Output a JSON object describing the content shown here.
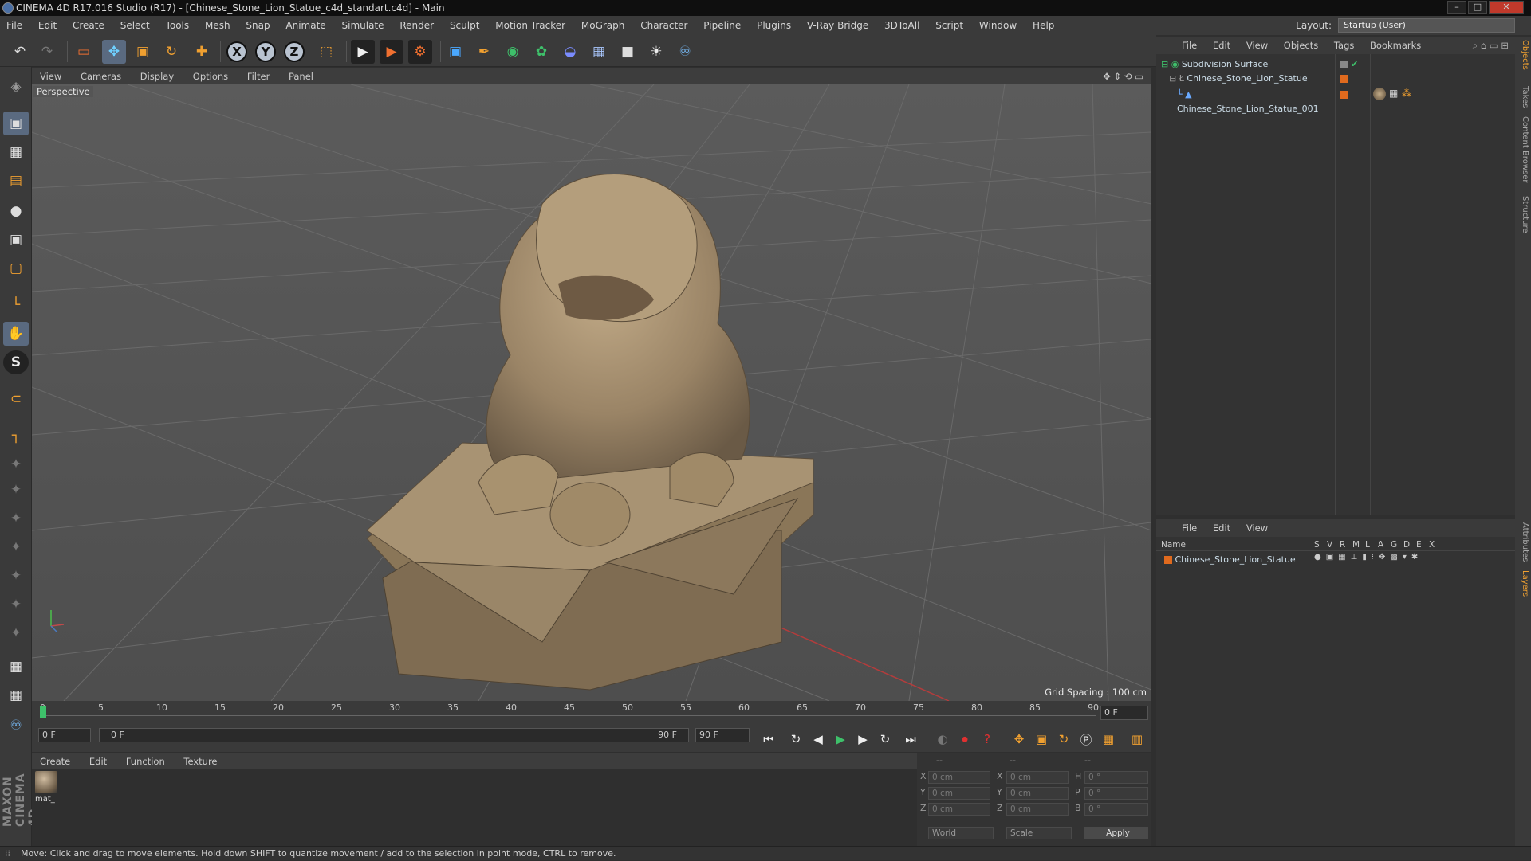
{
  "window": {
    "title": "CINEMA 4D R17.016 Studio (R17) - [Chinese_Stone_Lion_Statue_c4d_standart.c4d] - Main",
    "min": "–",
    "max": "□",
    "close": "✕"
  },
  "menubar": {
    "items": [
      "File",
      "Edit",
      "Create",
      "Select",
      "Tools",
      "Mesh",
      "Snap",
      "Animate",
      "Simulate",
      "Render",
      "Sculpt",
      "Motion Tracker",
      "MoGraph",
      "Character",
      "Pipeline",
      "Plugins",
      "V-Ray Bridge",
      "3DToAll",
      "Script",
      "Window",
      "Help"
    ],
    "layout_label": "Layout:",
    "layout_value": "Startup (User)"
  },
  "toolbar": {
    "undo": "↶",
    "redo": "↷",
    "select": "▭",
    "move": "✥",
    "scale": "▣",
    "rotate": "↻",
    "transform": "✚",
    "x": "X",
    "y": "Y",
    "z": "Z",
    "coord": "⬚",
    "render_view": "▶",
    "render_pv": "▶",
    "render_settings": "⚙",
    "cube": "▣",
    "pen": "✒",
    "nurbs": "◉",
    "array": "✿",
    "deformer": "◒",
    "floor": "▦",
    "camera": "■",
    "light": "☀",
    "python": "♾"
  },
  "lefttools": {
    "icons": [
      "◈",
      "▣",
      "▦",
      "▤",
      "●",
      "▣",
      "▢",
      "└",
      "✋",
      "S",
      "⊂",
      "┐",
      "✦",
      "✦",
      "✦",
      "✦",
      "✦",
      "✦",
      "✦",
      "▦",
      "▦",
      "♾"
    ],
    "logo": "MAXON CINEMA 4D"
  },
  "viewport": {
    "menu": [
      "View",
      "Cameras",
      "Display",
      "Options",
      "Filter",
      "Panel"
    ],
    "camera": "Perspective",
    "grid_spacing": "Grid Spacing : 100 cm"
  },
  "timeline": {
    "ticks": [
      "0",
      "5",
      "10",
      "15",
      "20",
      "25",
      "30",
      "35",
      "40",
      "45",
      "50",
      "55",
      "60",
      "65",
      "70",
      "75",
      "80",
      "85",
      "90"
    ],
    "current": "0 F",
    "start": "0 F",
    "range_start": "0 F",
    "range_end": "90 F",
    "end": "90 F"
  },
  "playback": {
    "first": "⏮",
    "loop": "↻",
    "prev": "◀",
    "play": "▶",
    "next": "▶",
    "cycle": "↻",
    "last": "⏭"
  },
  "material": {
    "menu": [
      "Create",
      "Edit",
      "Function",
      "Texture"
    ],
    "items": [
      {
        "name": "mat_"
      }
    ]
  },
  "coords": {
    "headers": [
      "--",
      "--",
      "--"
    ],
    "pos": [
      {
        "axis": "X",
        "value": "0 cm"
      },
      {
        "axis": "Y",
        "value": "0 cm"
      },
      {
        "axis": "Z",
        "value": "0 cm"
      }
    ],
    "size": [
      {
        "axis": "X",
        "value": "0 cm"
      },
      {
        "axis": "Y",
        "value": "0 cm"
      },
      {
        "axis": "Z",
        "value": "0 cm"
      }
    ],
    "rot": [
      {
        "axis": "H",
        "value": "0 °"
      },
      {
        "axis": "P",
        "value": "0 °"
      },
      {
        "axis": "B",
        "value": "0 °"
      }
    ],
    "world": "World",
    "scale": "Scale",
    "apply": "Apply"
  },
  "objects": {
    "menu": [
      "File",
      "Edit",
      "View",
      "Objects",
      "Tags",
      "Bookmarks"
    ],
    "items": [
      {
        "name": "Subdivision Surface",
        "level": 0
      },
      {
        "name": "Chinese_Stone_Lion_Statue",
        "level": 1
      },
      {
        "name": "Chinese_Stone_Lion_Statue_001",
        "level": 2
      }
    ]
  },
  "layers": {
    "menu": [
      "File",
      "Edit",
      "View"
    ],
    "header_name": "Name",
    "header_cols": [
      "S",
      "V",
      "R",
      "M",
      "L",
      "A",
      "G",
      "D",
      "E",
      "X"
    ],
    "items": [
      {
        "name": "Chinese_Stone_Lion_Statue"
      }
    ]
  },
  "right_tabs": [
    "Objects",
    "Takes",
    "Content Browser",
    "Structure",
    "Attributes",
    "Layers"
  ],
  "status": "Move: Click and drag to move elements. Hold down SHIFT to quantize movement / add to the selection in point mode, CTRL to remove.",
  "colors": {
    "accent": "#f0a030",
    "panel": "#333333",
    "viewport_bg": "#555555",
    "statue": "#a08a6a"
  }
}
